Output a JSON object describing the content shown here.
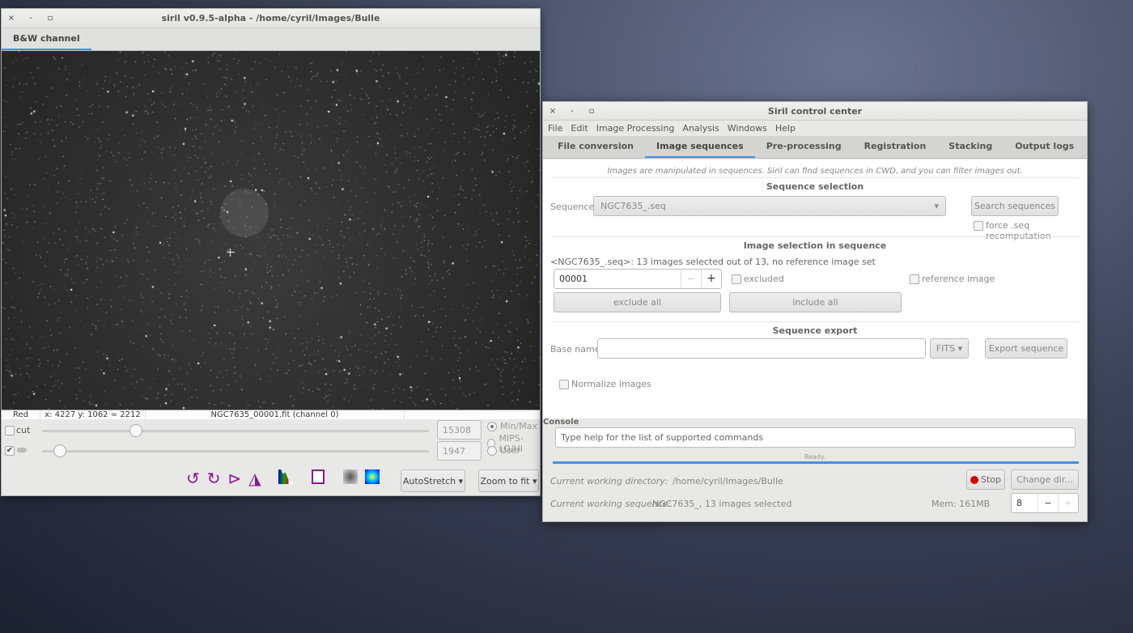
{
  "image_window": {
    "title": "siril v0.9.5-alpha - /home/cyril/Images/Bulle",
    "controls": {
      "close": "×",
      "minimize": "-",
      "maximize": "▫"
    },
    "tab": "B&W channel",
    "status": {
      "channel": "Red",
      "coords": "x: 4227 y: 1062 = 2212",
      "filename": "NGC7635_00001.fit (channel 0)"
    },
    "cut_label": "cut",
    "cut_checked": false,
    "link_checked": true,
    "high_value": "15308",
    "low_value": "1947",
    "high_slider_fraction": 0.23,
    "low_slider_fraction": 0.03,
    "scale_modes": [
      {
        "label": "Min/Max",
        "selected": true
      },
      {
        "label": "MIPS-LO/HI",
        "selected": false
      },
      {
        "label": "User",
        "selected": false
      }
    ],
    "autostretch_label": "AutoStretch",
    "zoom_label": "Zoom to fit",
    "icons": [
      "rotate-left-icon",
      "rotate-right-icon",
      "mirror-x-icon",
      "mirror-y-icon",
      "histogram-icon",
      "image-info-icon",
      "negative-view-icon",
      "false-color-icon"
    ]
  },
  "control_center": {
    "title": "Siril control center",
    "controls": {
      "close": "×",
      "minimize": "-",
      "maximize": "▫"
    },
    "menu": [
      "File",
      "Edit",
      "Image Processing",
      "Analysis",
      "Windows",
      "Help"
    ],
    "tabs": [
      {
        "label": "File conversion",
        "active": false
      },
      {
        "label": "Image sequences",
        "active": true
      },
      {
        "label": "Pre-processing",
        "active": false
      },
      {
        "label": "Registration",
        "active": false
      },
      {
        "label": "Stacking",
        "active": false
      },
      {
        "label": "Output logs",
        "active": false
      }
    ],
    "hint": "Images are manipulated in sequences. Siril can find sequences in CWD, and you can filter images out.",
    "sequence_selection": {
      "heading": "Sequence selection",
      "label": "Sequence:",
      "value": "NGC7635_.seq",
      "search_button": "Search sequences",
      "force_label": "force .seq recomputation"
    },
    "image_selection": {
      "heading": "Image selection in sequence",
      "info": "<NGC7635_.seq>: 13 images selected out of 13, no reference image set",
      "image_number": "00001",
      "minus": "−",
      "plus": "+",
      "excluded_label": "excluded",
      "reference_label": "reference image",
      "exclude_all": "exclude all",
      "include_all": "include all"
    },
    "export": {
      "heading": "Sequence export",
      "base_label": "Base name:",
      "base_value": "",
      "format": "FITS",
      "export_button": "Export sequence",
      "normalize_label": "Normalize images"
    },
    "console": {
      "label": "Console",
      "placeholder": "Type help for the list of supported commands",
      "status": "Ready.",
      "progress": 1.0,
      "cwd_label": "Current working directory:",
      "cwd_value": "/home/cyril/Images/Bulle",
      "seq_label": "Current working sequence:",
      "seq_value": "NGC7635_, 13 images selected",
      "stop_button": "Stop",
      "change_dir_button": "Change dir...",
      "mem": "Mem: 161MB",
      "threads": "8",
      "minus": "−",
      "plus": "+"
    }
  },
  "colors": {
    "accent": "#4a90d9",
    "stop": "#d00000",
    "icon_purple": "#8b1a8b"
  }
}
